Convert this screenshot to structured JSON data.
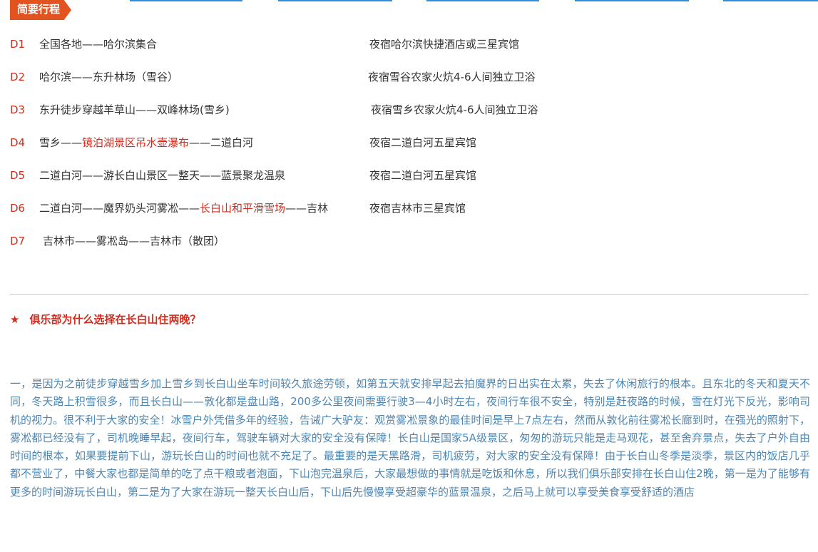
{
  "section_tab": "简要行程",
  "itinerary": [
    {
      "day": "D1",
      "route": [
        "全国各地——哈尔滨集合"
      ],
      "stay": "夜宿哈尔滨快捷酒店或三星宾馆"
    },
    {
      "day": "D2",
      "route": [
        "哈尔滨——东升林场（雪谷）"
      ],
      "stay": "夜宿雪谷农家火炕4-6人间独立卫浴"
    },
    {
      "day": "D3",
      "route": [
        "东升徒步穿越羊草山——双峰林场(雪乡)"
      ],
      "stay": "夜宿雪乡农家火炕4-6人间独立卫浴"
    },
    {
      "day": "D4",
      "route": [
        "雪乡——",
        "镜泊湖景区吊水壶瀑布",
        "——二道白河"
      ],
      "stay": "夜宿二道白河五星宾馆"
    },
    {
      "day": "D5",
      "route": [
        "二道白河——游长白山景区一整天——蓝景聚龙温泉"
      ],
      "stay": "夜宿二道白河五星宾馆"
    },
    {
      "day": "D6",
      "route": [
        "二道白河——魔界奶头河雾凇——",
        "长白山和平滑雪场",
        "——吉林"
      ],
      "stay": "夜宿吉林市三星宾馆"
    },
    {
      "day": "D7",
      "route": [
        "吉林市——雾凇岛——吉林市（散团）"
      ],
      "stay": ""
    }
  ],
  "question": {
    "star": "★",
    "text": "俱乐部为什么选择在长白山住两晚？"
  },
  "answer": "一，是因为之前徒步穿越雪乡加上雪乡到长白山坐车时间较久旅途劳顿，如第五天就安排早起去拍魔界的日出实在太累，失去了休闲旅行的根本。且东北的冬天和夏天不同，冬天路上积雪很多，而且长白山——敦化都是盘山路，200多公里夜间需要行驶3—4小时左右，夜间行车很不安全，特别是赶夜路的时候，雪在灯光下反光，影响司机的视力。很不利于大家的安全！冰雪户外凭借多年的经验，告诫广大驴友：观赏雾凇景象的最佳时间是早上7点左右，然而从敦化前往雾凇长廊到时，在强光的照射下，雾凇都已经没有了，司机晚睡早起，夜间行车，驾驶车辆对大家的安全没有保障！长白山是国家5A级景区，匆匆的游玩只能是走马观花，甚至舍弃景点，失去了户外自由时间的根本，如果要提前下山，游玩长白山的时间也就不充足了。最重要的是天黑路滑，司机疲劳，对大家的安全没有保障！由于长白山冬季是淡季，景区内的饭店几乎都不营业了，中餐大家也都是简单的吃了点干粮或者泡面，下山泡完温泉后，大家最想做的事情就是吃饭和休息，所以我们俱乐部安排在长白山住2晚，第一是为了能够有更多的时间游玩长白山，第二是为了大家在游玩一整天长白山后，下山后先慢慢享受超豪华的蓝景温泉，之后马上就可以享受美食享受舒适的酒店"
}
